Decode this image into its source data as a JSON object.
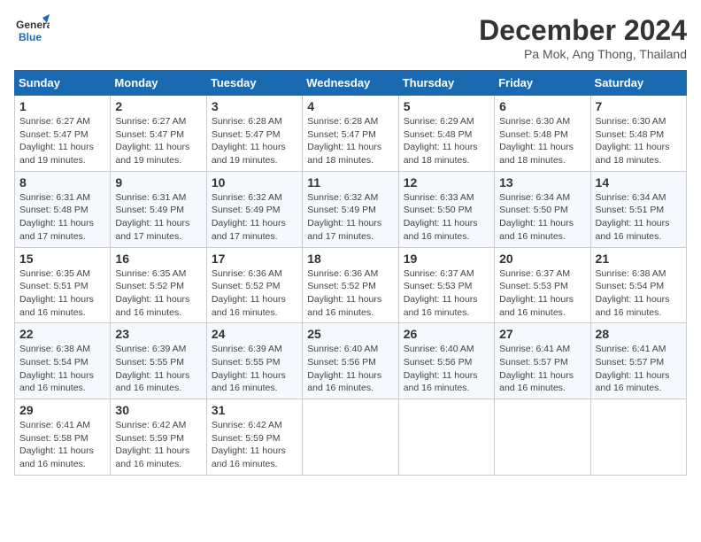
{
  "logo": {
    "line1": "General",
    "line2": "Blue"
  },
  "title": "December 2024",
  "location": "Pa Mok, Ang Thong, Thailand",
  "headers": [
    "Sunday",
    "Monday",
    "Tuesday",
    "Wednesday",
    "Thursday",
    "Friday",
    "Saturday"
  ],
  "weeks": [
    [
      {
        "day": "1",
        "sunrise": "6:27 AM",
        "sunset": "5:47 PM",
        "daylight": "11 hours and 19 minutes."
      },
      {
        "day": "2",
        "sunrise": "6:27 AM",
        "sunset": "5:47 PM",
        "daylight": "11 hours and 19 minutes."
      },
      {
        "day": "3",
        "sunrise": "6:28 AM",
        "sunset": "5:47 PM",
        "daylight": "11 hours and 19 minutes."
      },
      {
        "day": "4",
        "sunrise": "6:28 AM",
        "sunset": "5:47 PM",
        "daylight": "11 hours and 18 minutes."
      },
      {
        "day": "5",
        "sunrise": "6:29 AM",
        "sunset": "5:48 PM",
        "daylight": "11 hours and 18 minutes."
      },
      {
        "day": "6",
        "sunrise": "6:30 AM",
        "sunset": "5:48 PM",
        "daylight": "11 hours and 18 minutes."
      },
      {
        "day": "7",
        "sunrise": "6:30 AM",
        "sunset": "5:48 PM",
        "daylight": "11 hours and 18 minutes."
      }
    ],
    [
      {
        "day": "8",
        "sunrise": "6:31 AM",
        "sunset": "5:48 PM",
        "daylight": "11 hours and 17 minutes."
      },
      {
        "day": "9",
        "sunrise": "6:31 AM",
        "sunset": "5:49 PM",
        "daylight": "11 hours and 17 minutes."
      },
      {
        "day": "10",
        "sunrise": "6:32 AM",
        "sunset": "5:49 PM",
        "daylight": "11 hours and 17 minutes."
      },
      {
        "day": "11",
        "sunrise": "6:32 AM",
        "sunset": "5:49 PM",
        "daylight": "11 hours and 17 minutes."
      },
      {
        "day": "12",
        "sunrise": "6:33 AM",
        "sunset": "5:50 PM",
        "daylight": "11 hours and 16 minutes."
      },
      {
        "day": "13",
        "sunrise": "6:34 AM",
        "sunset": "5:50 PM",
        "daylight": "11 hours and 16 minutes."
      },
      {
        "day": "14",
        "sunrise": "6:34 AM",
        "sunset": "5:51 PM",
        "daylight": "11 hours and 16 minutes."
      }
    ],
    [
      {
        "day": "15",
        "sunrise": "6:35 AM",
        "sunset": "5:51 PM",
        "daylight": "11 hours and 16 minutes."
      },
      {
        "day": "16",
        "sunrise": "6:35 AM",
        "sunset": "5:52 PM",
        "daylight": "11 hours and 16 minutes."
      },
      {
        "day": "17",
        "sunrise": "6:36 AM",
        "sunset": "5:52 PM",
        "daylight": "11 hours and 16 minutes."
      },
      {
        "day": "18",
        "sunrise": "6:36 AM",
        "sunset": "5:52 PM",
        "daylight": "11 hours and 16 minutes."
      },
      {
        "day": "19",
        "sunrise": "6:37 AM",
        "sunset": "5:53 PM",
        "daylight": "11 hours and 16 minutes."
      },
      {
        "day": "20",
        "sunrise": "6:37 AM",
        "sunset": "5:53 PM",
        "daylight": "11 hours and 16 minutes."
      },
      {
        "day": "21",
        "sunrise": "6:38 AM",
        "sunset": "5:54 PM",
        "daylight": "11 hours and 16 minutes."
      }
    ],
    [
      {
        "day": "22",
        "sunrise": "6:38 AM",
        "sunset": "5:54 PM",
        "daylight": "11 hours and 16 minutes."
      },
      {
        "day": "23",
        "sunrise": "6:39 AM",
        "sunset": "5:55 PM",
        "daylight": "11 hours and 16 minutes."
      },
      {
        "day": "24",
        "sunrise": "6:39 AM",
        "sunset": "5:55 PM",
        "daylight": "11 hours and 16 minutes."
      },
      {
        "day": "25",
        "sunrise": "6:40 AM",
        "sunset": "5:56 PM",
        "daylight": "11 hours and 16 minutes."
      },
      {
        "day": "26",
        "sunrise": "6:40 AM",
        "sunset": "5:56 PM",
        "daylight": "11 hours and 16 minutes."
      },
      {
        "day": "27",
        "sunrise": "6:41 AM",
        "sunset": "5:57 PM",
        "daylight": "11 hours and 16 minutes."
      },
      {
        "day": "28",
        "sunrise": "6:41 AM",
        "sunset": "5:57 PM",
        "daylight": "11 hours and 16 minutes."
      }
    ],
    [
      {
        "day": "29",
        "sunrise": "6:41 AM",
        "sunset": "5:58 PM",
        "daylight": "11 hours and 16 minutes."
      },
      {
        "day": "30",
        "sunrise": "6:42 AM",
        "sunset": "5:59 PM",
        "daylight": "11 hours and 16 minutes."
      },
      {
        "day": "31",
        "sunrise": "6:42 AM",
        "sunset": "5:59 PM",
        "daylight": "11 hours and 16 minutes."
      },
      null,
      null,
      null,
      null
    ]
  ],
  "labels": {
    "sunrise": "Sunrise: ",
    "sunset": "Sunset: ",
    "daylight": "Daylight: "
  }
}
